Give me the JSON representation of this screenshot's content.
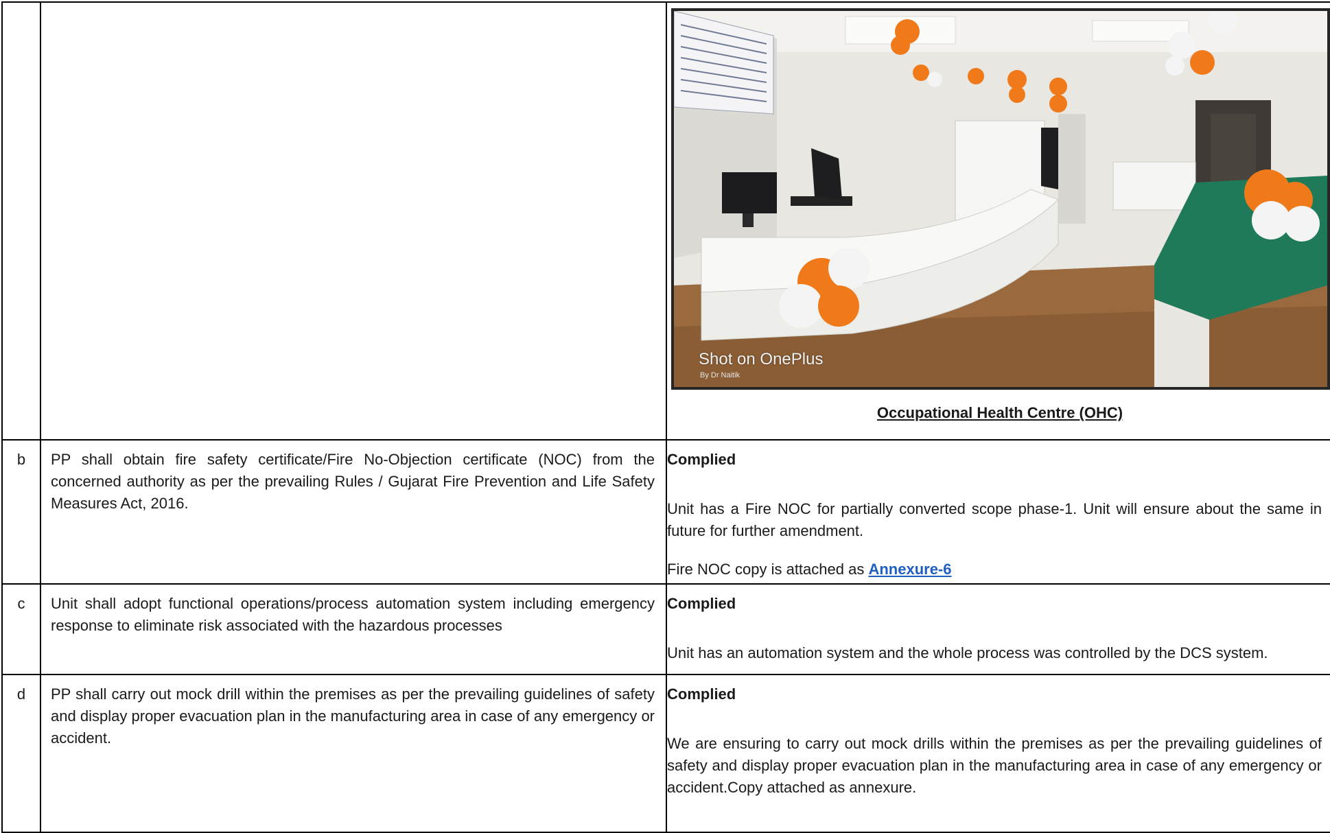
{
  "rows": [
    {
      "id": "",
      "condition": "",
      "photo": {
        "watermark": "Shot on OnePlus",
        "watermark_sub": "By Dr Naitik"
      },
      "caption": "Occupational Health Centre (OHC)"
    },
    {
      "id": "b",
      "condition": "PP shall obtain fire safety certificate/Fire No-Objection certificate (NOC) from the concerned authority as per the prevailing Rules / Gujarat Fire Prevention and Life Safety Measures Act, 2016.",
      "status": "Complied",
      "details": [
        "Unit has a Fire NOC for partially converted scope phase-1. Unit will ensure about the same in future for further amendment."
      ],
      "attachment_prefix": "Fire NOC copy is attached as ",
      "attachment_link": "Annexure-6"
    },
    {
      "id": "c",
      "condition": "Unit shall adopt functional operations/process automation system including emergency response to eliminate risk associated with the hazardous processes",
      "status": "Complied",
      "details": [
        "Unit has an automation system and the whole process was controlled by the DCS system."
      ]
    },
    {
      "id": "d",
      "condition": " PP shall carry out mock drill within the premises as per the prevailing guidelines of safety and display proper evacuation plan in the manufacturing area in case of any emergency or accident.",
      "status": "Complied",
      "details": [
        "We are ensuring to carry out mock drills within the premises as per the prevailing guidelines of safety and display proper evacuation plan in the manufacturing area in case of any emergency or accident.Copy attached as annexure."
      ]
    }
  ],
  "colors": {
    "border": "#000000",
    "link": "#1f5fbf",
    "bedsheet": "#1f7a5a",
    "balloon_orange": "#f07a1a",
    "floor": "#9a6a3e"
  }
}
